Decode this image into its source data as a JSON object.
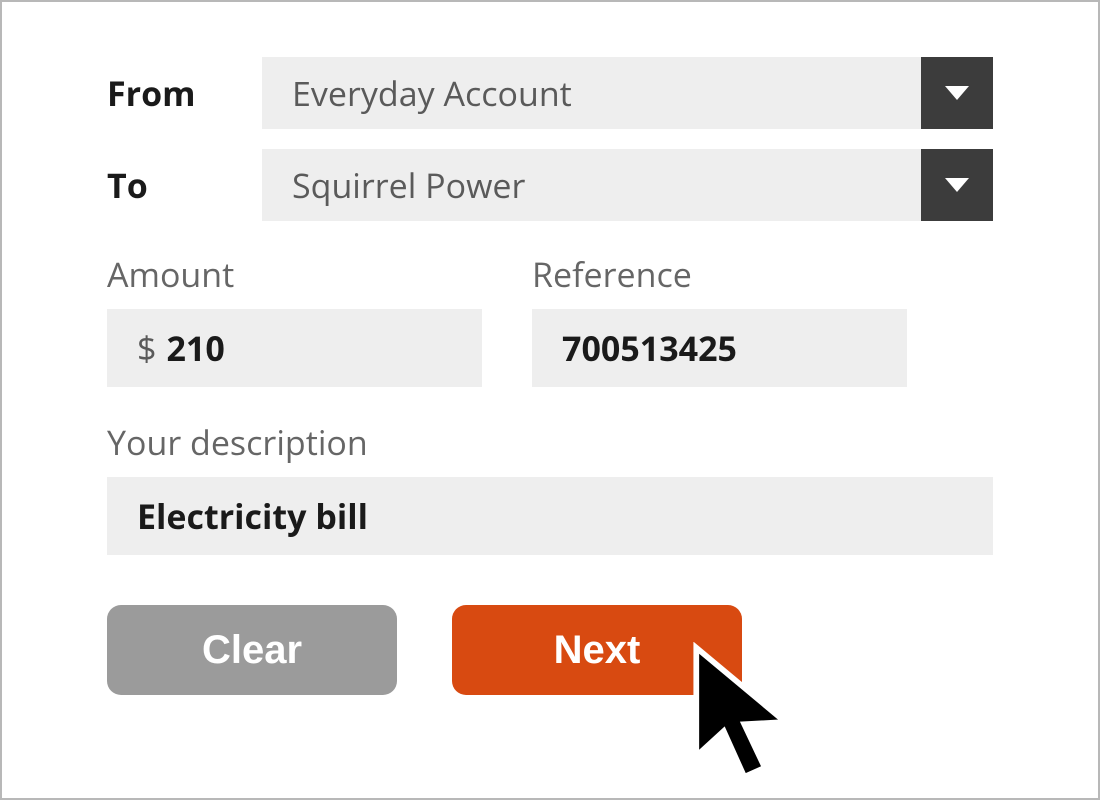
{
  "form": {
    "from": {
      "label": "From",
      "value": "Everyday Account"
    },
    "to": {
      "label": "To",
      "value": "Squirrel Power"
    },
    "amount": {
      "label": "Amount",
      "currency": "$",
      "value": "210"
    },
    "reference": {
      "label": "Reference",
      "value": "700513425"
    },
    "description": {
      "label": "Your description",
      "value": "Electricity bill"
    }
  },
  "buttons": {
    "clear": "Clear",
    "next": "Next"
  },
  "colors": {
    "accent": "#d84a11",
    "input_bg": "#eeeeee",
    "dropdown_arrow_bg": "#3c3c3c",
    "muted_button": "#9b9b9b"
  }
}
